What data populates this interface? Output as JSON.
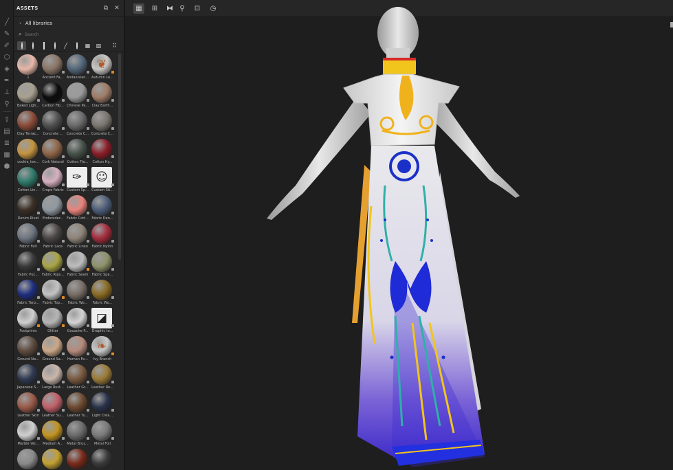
{
  "panel": {
    "title": "ASSETS",
    "library": "All libraries",
    "search_placeholder": "Search"
  },
  "filters": [
    {
      "name": "filter-all-materials",
      "icon": "material-ball-icon",
      "active": true
    },
    {
      "name": "filter-smart-materials",
      "icon": "half-ball-icon",
      "active": false
    },
    {
      "name": "filter-materials",
      "icon": "square-material-icon",
      "active": false
    },
    {
      "name": "filter-smart-masks",
      "icon": "half-circle-icon",
      "active": false
    },
    {
      "name": "filter-brushes",
      "icon": "brush-icon",
      "active": false
    },
    {
      "name": "filter-textures",
      "icon": "sphere-icon",
      "active": false
    },
    {
      "name": "filter-procedurals",
      "icon": "grid-pattern-icon",
      "active": false
    },
    {
      "name": "filter-images",
      "icon": "image-icon",
      "active": false
    }
  ],
  "assets": [
    {
      "label": "1",
      "color": "#e7b7a8",
      "badge": ""
    },
    {
      "label": "Ancient Fa...",
      "color": "#8a7566",
      "badge": "grey"
    },
    {
      "label": "Andalusian...",
      "color": "#53667a",
      "badge": "grey"
    },
    {
      "label": "Autumn Le...",
      "color": "#c9c6c2",
      "badge": "orange",
      "icon": "leaf-icon"
    },
    {
      "label": "Baked Ligh...",
      "color": "#a8a090",
      "badge": "grey"
    },
    {
      "label": "Carbon Fib...",
      "color": "#0c0c0c",
      "badge": "grey"
    },
    {
      "label": "Chinese Pa...",
      "color": "#9a9a9a",
      "badge": "grey"
    },
    {
      "label": "Clay Earth...",
      "color": "#9f7c67",
      "badge": "grey"
    },
    {
      "label": "Clay Terrac...",
      "color": "#8a4b38",
      "badge": "grey"
    },
    {
      "label": "Concrete ...",
      "color": "#505050",
      "badge": "grey"
    },
    {
      "label": "Concrete C...",
      "color": "#6a6a6a",
      "badge": "grey"
    },
    {
      "label": "Concrete C...",
      "color": "#7a7670",
      "badge": "grey"
    },
    {
      "label": "cookie_tex...",
      "color": "#c49340",
      "badge": ""
    },
    {
      "label": "Cork Natural",
      "color": "#8f6548",
      "badge": "grey"
    },
    {
      "label": "Cotton Fla...",
      "color": "#46534a",
      "badge": "grey"
    },
    {
      "label": "Cotton Hy...",
      "color": "#8c1d28",
      "badge": "grey"
    },
    {
      "label": "Cotton Lin...",
      "color": "#2f7a6c",
      "badge": "grey"
    },
    {
      "label": "Crepe Fabric",
      "color": "#d6b1c0",
      "badge": "grey"
    },
    {
      "label": "Custom Sp...",
      "color": "#eeeeee",
      "badge": "grey",
      "square": true,
      "icon": "brush-stroke-icon"
    },
    {
      "label": "Custom Sti...",
      "color": "#eeeeee",
      "badge": "grey",
      "square": true,
      "icon": "smiley-icon"
    },
    {
      "label": "Denim Rivet",
      "color": "#3b3026",
      "badge": "grey"
    },
    {
      "label": "Embroider...",
      "color": "#8f98a0",
      "badge": "grey"
    },
    {
      "label": "Fabric Cott...",
      "color": "#e8837c",
      "badge": "grey"
    },
    {
      "label": "Fabric Den...",
      "color": "#4d5d7a",
      "badge": "grey"
    },
    {
      "label": "Fabric Felt",
      "color": "#6e7680",
      "badge": "grey"
    },
    {
      "label": "Fabric Lace",
      "color": "#4b4545",
      "badge": "grey"
    },
    {
      "label": "Fabric Linen",
      "color": "#8e8478",
      "badge": "grey"
    },
    {
      "label": "Fabric Nylon",
      "color": "#a42c3c",
      "badge": "grey"
    },
    {
      "label": "Fabric Puc...",
      "color": "#3a3a3a",
      "badge": "grey"
    },
    {
      "label": "Fabric Rips...",
      "color": "#a8a445",
      "badge": "grey"
    },
    {
      "label": "Fabric Seam",
      "color": "#bdbdbd",
      "badge": "orange"
    },
    {
      "label": "Fabric Spa...",
      "color": "#8e926a",
      "badge": "grey"
    },
    {
      "label": "Fabric Tarp...",
      "color": "#1e2f80",
      "badge": "grey"
    },
    {
      "label": "Fabric Top...",
      "color": "#c4c4c4",
      "badge": "orange"
    },
    {
      "label": "Fabric Wo...",
      "color": "#786e66",
      "badge": "grey"
    },
    {
      "label": "Fabric Wo...",
      "color": "#8a6a22",
      "badge": "grey"
    },
    {
      "label": "Footprints",
      "color": "#cfcfcf",
      "badge": "orange"
    },
    {
      "label": "Glitter",
      "color": "#b5b5b5",
      "badge": "orange"
    },
    {
      "label": "Gouache P...",
      "color": "#d4d4d4",
      "badge": "grey"
    },
    {
      "label": "Graphic to...",
      "color": "#eeeeee",
      "badge": "grey",
      "square": true,
      "icon": "graphic-tool-icon"
    },
    {
      "label": "Ground Na...",
      "color": "#5e4c40",
      "badge": "grey"
    },
    {
      "label": "Ground Sa...",
      "color": "#cba888",
      "badge": "grey"
    },
    {
      "label": "Human Fe...",
      "color": "#b58a7a",
      "badge": "grey"
    },
    {
      "label": "Ivy Branch",
      "color": "#c7c7c7",
      "badge": "orange",
      "icon": "ivy-icon"
    },
    {
      "label": "Japanese S...",
      "color": "#2f3a52",
      "badge": "grey"
    },
    {
      "label": "Large Rust...",
      "color": "#c9b5ab",
      "badge": "grey"
    },
    {
      "label": "Leather Gr...",
      "color": "#7a5a40",
      "badge": "grey"
    },
    {
      "label": "Leather Re...",
      "color": "#9a7a38",
      "badge": "grey"
    },
    {
      "label": "Leather Skin",
      "color": "#9a5a48",
      "badge": "grey"
    },
    {
      "label": "Leather Su...",
      "color": "#c06068",
      "badge": "grey"
    },
    {
      "label": "Leather Tu...",
      "color": "#6e4a30",
      "badge": "grey"
    },
    {
      "label": "Light Crea...",
      "color": "#2a324a",
      "badge": "grey"
    },
    {
      "label": "Marble Vei...",
      "color": "#d0d0d0",
      "badge": "grey"
    },
    {
      "label": "Medium A...",
      "color": "#c29420",
      "badge": "grey"
    },
    {
      "label": "Metal Brus...",
      "color": "#6a6a6a",
      "badge": "grey"
    },
    {
      "label": "Metal Foil",
      "color": "#7a7a7a",
      "badge": "grey"
    },
    {
      "label": "",
      "color": "#8a8a8a",
      "badge": ""
    },
    {
      "label": "",
      "color": "#c2a030",
      "badge": ""
    },
    {
      "label": "",
      "color": "#7a2a1a",
      "badge": ""
    },
    {
      "label": "",
      "color": "#3a3a3a",
      "badge": ""
    }
  ],
  "viewport_tools": [
    {
      "name": "view-single-button",
      "icon": "grid-single-icon",
      "active": true
    },
    {
      "name": "view-split-button",
      "icon": "grid-split-icon",
      "active": false
    },
    {
      "name": "symmetry-button",
      "icon": "symmetry-icon",
      "active": false
    },
    {
      "name": "pose-button",
      "icon": "figure-icon",
      "active": false
    },
    {
      "name": "frame-button",
      "icon": "frame-icon",
      "active": false
    },
    {
      "name": "history-button",
      "icon": "clock-icon",
      "active": false
    }
  ]
}
